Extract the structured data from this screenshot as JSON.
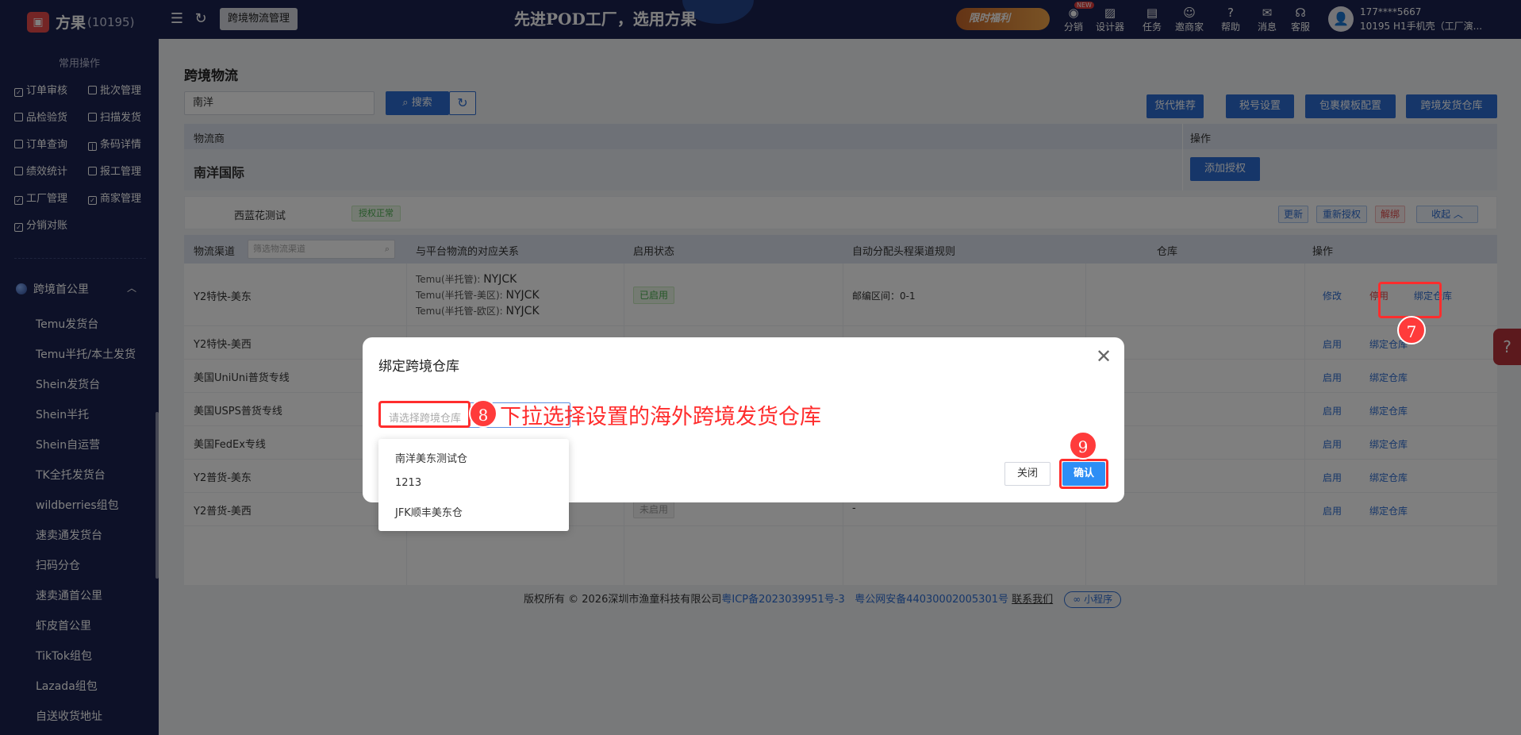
{
  "header": {
    "brand": "方果",
    "brand_id": "(10195)",
    "module_tag": "跨境物流管理",
    "banner": "先进POD工厂，选用方果",
    "promo": "限时福利",
    "new_badge": "NEW",
    "tools": [
      "分销",
      "设计器",
      "任务",
      "邀商家",
      "帮助",
      "消息",
      "客服"
    ],
    "user_phone": "177****5667",
    "user_name": "10195  H1手机壳（工厂演..."
  },
  "sidebar": {
    "section_title": "常用操作",
    "quick_left": [
      "订单审核",
      "品检验货",
      "订单查询",
      "绩效统计",
      "工厂管理",
      "分销对账"
    ],
    "quick_right": [
      "批次管理",
      "扫描发货",
      "条码详情",
      "报工管理",
      "商家管理"
    ],
    "group": "跨境首公里",
    "items": [
      "Temu发货台",
      "Temu半托/本土发货",
      "Shein发货台",
      "Shein半托",
      "Shein自运营",
      "TK全托发货台",
      "wildberries组包",
      "速卖通发货台",
      "扫码分仓",
      "速卖通首公里",
      "虾皮首公里",
      "TikTok组包",
      "Lazada组包",
      "自送收货地址"
    ]
  },
  "page": {
    "title": "跨境物流",
    "search_value": "南洋",
    "search_btn": "搜索",
    "actions": [
      "货代推荐",
      "税号设置",
      "包裹模板配置",
      "跨境发货仓库"
    ]
  },
  "provider_table": {
    "col_provider": "物流商",
    "col_ops": "操作",
    "provider": "南洋国际",
    "add_auth": "添加授权",
    "account": "西蓝花测试",
    "auth_status": "授权正常",
    "account_btns": [
      "更新",
      "重新授权",
      "解绑",
      "收起"
    ]
  },
  "channel_table": {
    "headers": [
      "物流渠道",
      "与平台物流的对应关系",
      "启用状态",
      "自动分配头程渠道规则",
      "仓库",
      "操作"
    ],
    "filter_placeholder": "筛选物流渠道",
    "rows": [
      {
        "name": "Y2特快-美东",
        "mapping": [
          {
            "k": "Temu(半托管): ",
            "v": "NYJCK"
          },
          {
            "k": "Temu(半托管-美区): ",
            "v": "NYJCK"
          },
          {
            "k": "Temu(半托管-欧区): ",
            "v": "NYJCK"
          }
        ],
        "status": "已启用",
        "rule": "邮编区间：0-1",
        "ops": [
          "修改",
          "停用",
          "绑定仓库"
        ]
      },
      {
        "name": "Y2特快-美西",
        "ops": [
          "启用",
          "绑定仓库"
        ]
      },
      {
        "name": "美国UniUni普货专线",
        "ops": [
          "启用",
          "绑定仓库"
        ]
      },
      {
        "name": "美国USPS普货专线",
        "ops": [
          "启用",
          "绑定仓库"
        ]
      },
      {
        "name": "美国FedEx专线",
        "ops": [
          "启用",
          "绑定仓库"
        ]
      },
      {
        "name": "Y2普货-美东",
        "ops": [
          "启用",
          "绑定仓库"
        ]
      },
      {
        "name": "Y2普货-美西",
        "status": "未启用",
        "rule": "-",
        "ops": [
          "启用",
          "绑定仓库"
        ]
      }
    ]
  },
  "footer": {
    "copyright": "版权所有 © 2026深圳市渔童科技有限公司",
    "icp": "粤ICP备2023039951号-3",
    "police": "粤公网安备44030002005301号",
    "contact": "联系我们",
    "miniapp": "小程序"
  },
  "modal": {
    "title": "绑定跨境仓库",
    "select_placeholder": "请选择跨境仓库",
    "options": [
      "南洋美东测试仓",
      "1213",
      "JFK顺丰美东仓"
    ],
    "close_btn": "关闭",
    "confirm_btn": "确认"
  },
  "annotations": {
    "step7": "7",
    "step8": "8",
    "step9": "9",
    "instruction": "下拉选择设置的海外跨境发货仓库"
  },
  "colors": {
    "nav": "#1b2350",
    "primary": "#2d6dd2",
    "highlight": "#ff2d2d"
  }
}
